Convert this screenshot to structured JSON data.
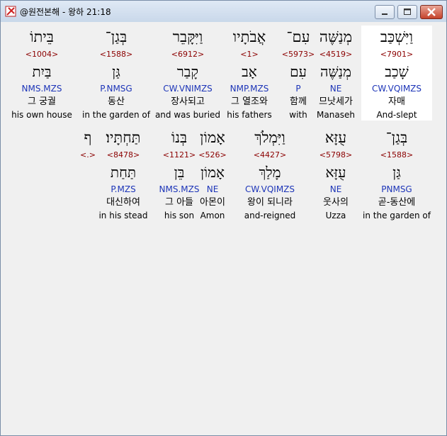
{
  "window": {
    "title": "@원전본해 - 왕하 21:18"
  },
  "rows": [
    [
      {
        "heb": "וַיִּשְׁכַּב",
        "strong": "<7901>",
        "lemma": "שָׁכַב",
        "morph": "CW.VQIMZS",
        "kor": "자매",
        "eng": "And-slept",
        "selected": true
      },
      {
        "heb": "מְנַשֶּׁה",
        "strong": "<4519>",
        "lemma": "מְנַשֶּׁה",
        "morph": "NE",
        "kor": "므낫세가",
        "eng": "Manaseh"
      },
      {
        "heb": "עִם־",
        "strong": "<5973>",
        "lemma": "עִם",
        "morph": "P",
        "kor": "함께",
        "eng": "with"
      },
      {
        "heb": "אֲבֹתָיו",
        "strong": "<1>",
        "lemma": "אָב",
        "morph": "NMP.MZS",
        "kor": "그 열조와",
        "eng": "his fathers"
      },
      {
        "heb": "וַיִּקָּבֵר",
        "strong": "<6912>",
        "lemma": "קָבַר",
        "morph": "CW.VNIMZS",
        "kor": "장사되고",
        "eng": "and was buried"
      },
      {
        "heb": "בְּגַן־",
        "strong": "<1588>",
        "lemma": "גַּן",
        "morph": "P.NMSG",
        "kor": "동산",
        "eng": "in the garden of"
      },
      {
        "heb": "בֵּיתוֹ",
        "strong": "<1004>",
        "lemma": "בַּיִת",
        "morph": "NMS.MZS",
        "kor": "그 궁궐",
        "eng": "his own house"
      }
    ],
    [
      {
        "heb": "בְּגַן־",
        "strong": "<1588>",
        "lemma": "גַּן",
        "morph": "PNMSG",
        "kor": "곧-동산에",
        "eng": "in the garden of"
      },
      {
        "heb": "עֻזָּא",
        "strong": "<5798>",
        "lemma": "עֻזָּא",
        "morph": "NE",
        "kor": "웃사의",
        "eng": "Uzza"
      },
      {
        "heb": "וַיִּמְלֹךְ",
        "strong": "<4427>",
        "lemma": "מָלַךְ",
        "morph": "CW.VQIMZS",
        "kor": "왕이 되니라",
        "eng": "and-reigned"
      },
      {
        "heb": "אָמוֹן",
        "strong": "<526>",
        "lemma": "אָמוֹן",
        "morph": "NE",
        "kor": "아몬이",
        "eng": "Amon"
      },
      {
        "heb": "בְּנוֹ",
        "strong": "<1121>",
        "lemma": "בֵּן",
        "morph": "NMS.MZS",
        "kor": "그 아들",
        "eng": "his son"
      },
      {
        "heb": "תַּחְתָּיו׃",
        "strong": "<8478>",
        "lemma": "תַּחַת",
        "morph": "P.MZS",
        "kor": "대신하여",
        "eng": "in his stead"
      },
      {
        "heb": "ף",
        "strong": "<.>",
        "lemma": "",
        "morph": "",
        "kor": "",
        "eng": ""
      }
    ]
  ]
}
